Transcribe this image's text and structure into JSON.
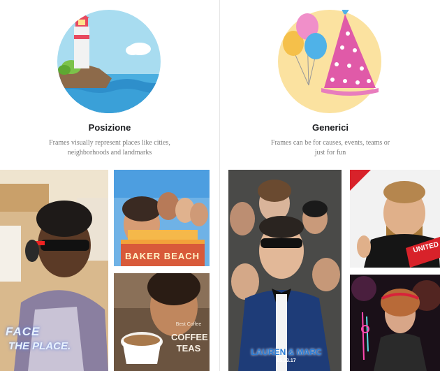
{
  "categories": [
    {
      "title": "Posizione",
      "description": "Frames visually represent places like cities, neighborhoods and landmarks",
      "illustration_icon": "lighthouse-icon"
    },
    {
      "title": "Generici",
      "description": "Frames can be for causes, events, teams or just for fun",
      "illustration_icon": "party-hat-balloons-icon"
    }
  ],
  "frame_examples": {
    "location": {
      "face_the_place_line1": "FACE",
      "face_the_place_line2": "THE PLACE.",
      "baker_beach": "BAKER BEACH",
      "coffee_small": "Best Coffee",
      "coffee_line1": "COFFEE",
      "coffee_line2": "TEAS"
    },
    "generic": {
      "wedding_names": "LAUREN & MARC",
      "wedding_date": "05.13.17",
      "team_banner": "UNITED"
    }
  },
  "colors": {
    "title_text": "#1c1e21",
    "desc_text": "#7a7a7a",
    "circle_blue": "#a8dcf0",
    "circle_yellow": "#fbe2a0",
    "hat_pink": "#e05aa8"
  }
}
